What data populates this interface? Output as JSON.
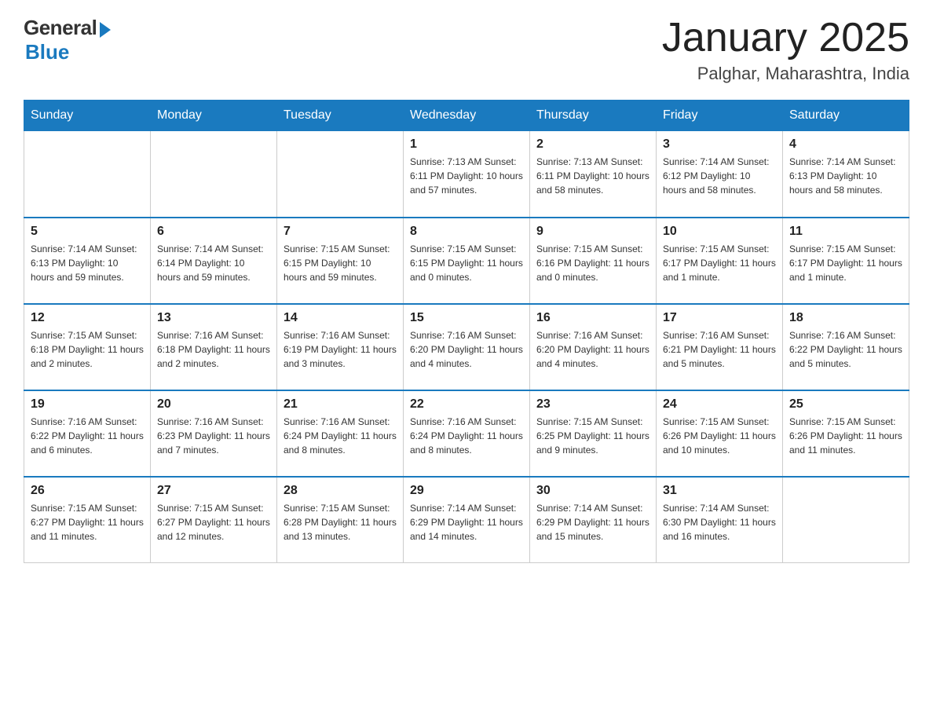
{
  "logo": {
    "general": "General",
    "blue": "Blue"
  },
  "title": "January 2025",
  "location": "Palghar, Maharashtra, India",
  "weekdays": [
    "Sunday",
    "Monday",
    "Tuesday",
    "Wednesday",
    "Thursday",
    "Friday",
    "Saturday"
  ],
  "weeks": [
    [
      {
        "day": "",
        "info": ""
      },
      {
        "day": "",
        "info": ""
      },
      {
        "day": "",
        "info": ""
      },
      {
        "day": "1",
        "info": "Sunrise: 7:13 AM\nSunset: 6:11 PM\nDaylight: 10 hours\nand 57 minutes."
      },
      {
        "day": "2",
        "info": "Sunrise: 7:13 AM\nSunset: 6:11 PM\nDaylight: 10 hours\nand 58 minutes."
      },
      {
        "day": "3",
        "info": "Sunrise: 7:14 AM\nSunset: 6:12 PM\nDaylight: 10 hours\nand 58 minutes."
      },
      {
        "day": "4",
        "info": "Sunrise: 7:14 AM\nSunset: 6:13 PM\nDaylight: 10 hours\nand 58 minutes."
      }
    ],
    [
      {
        "day": "5",
        "info": "Sunrise: 7:14 AM\nSunset: 6:13 PM\nDaylight: 10 hours\nand 59 minutes."
      },
      {
        "day": "6",
        "info": "Sunrise: 7:14 AM\nSunset: 6:14 PM\nDaylight: 10 hours\nand 59 minutes."
      },
      {
        "day": "7",
        "info": "Sunrise: 7:15 AM\nSunset: 6:15 PM\nDaylight: 10 hours\nand 59 minutes."
      },
      {
        "day": "8",
        "info": "Sunrise: 7:15 AM\nSunset: 6:15 PM\nDaylight: 11 hours\nand 0 minutes."
      },
      {
        "day": "9",
        "info": "Sunrise: 7:15 AM\nSunset: 6:16 PM\nDaylight: 11 hours\nand 0 minutes."
      },
      {
        "day": "10",
        "info": "Sunrise: 7:15 AM\nSunset: 6:17 PM\nDaylight: 11 hours\nand 1 minute."
      },
      {
        "day": "11",
        "info": "Sunrise: 7:15 AM\nSunset: 6:17 PM\nDaylight: 11 hours\nand 1 minute."
      }
    ],
    [
      {
        "day": "12",
        "info": "Sunrise: 7:15 AM\nSunset: 6:18 PM\nDaylight: 11 hours\nand 2 minutes."
      },
      {
        "day": "13",
        "info": "Sunrise: 7:16 AM\nSunset: 6:18 PM\nDaylight: 11 hours\nand 2 minutes."
      },
      {
        "day": "14",
        "info": "Sunrise: 7:16 AM\nSunset: 6:19 PM\nDaylight: 11 hours\nand 3 minutes."
      },
      {
        "day": "15",
        "info": "Sunrise: 7:16 AM\nSunset: 6:20 PM\nDaylight: 11 hours\nand 4 minutes."
      },
      {
        "day": "16",
        "info": "Sunrise: 7:16 AM\nSunset: 6:20 PM\nDaylight: 11 hours\nand 4 minutes."
      },
      {
        "day": "17",
        "info": "Sunrise: 7:16 AM\nSunset: 6:21 PM\nDaylight: 11 hours\nand 5 minutes."
      },
      {
        "day": "18",
        "info": "Sunrise: 7:16 AM\nSunset: 6:22 PM\nDaylight: 11 hours\nand 5 minutes."
      }
    ],
    [
      {
        "day": "19",
        "info": "Sunrise: 7:16 AM\nSunset: 6:22 PM\nDaylight: 11 hours\nand 6 minutes."
      },
      {
        "day": "20",
        "info": "Sunrise: 7:16 AM\nSunset: 6:23 PM\nDaylight: 11 hours\nand 7 minutes."
      },
      {
        "day": "21",
        "info": "Sunrise: 7:16 AM\nSunset: 6:24 PM\nDaylight: 11 hours\nand 8 minutes."
      },
      {
        "day": "22",
        "info": "Sunrise: 7:16 AM\nSunset: 6:24 PM\nDaylight: 11 hours\nand 8 minutes."
      },
      {
        "day": "23",
        "info": "Sunrise: 7:15 AM\nSunset: 6:25 PM\nDaylight: 11 hours\nand 9 minutes."
      },
      {
        "day": "24",
        "info": "Sunrise: 7:15 AM\nSunset: 6:26 PM\nDaylight: 11 hours\nand 10 minutes."
      },
      {
        "day": "25",
        "info": "Sunrise: 7:15 AM\nSunset: 6:26 PM\nDaylight: 11 hours\nand 11 minutes."
      }
    ],
    [
      {
        "day": "26",
        "info": "Sunrise: 7:15 AM\nSunset: 6:27 PM\nDaylight: 11 hours\nand 11 minutes."
      },
      {
        "day": "27",
        "info": "Sunrise: 7:15 AM\nSunset: 6:27 PM\nDaylight: 11 hours\nand 12 minutes."
      },
      {
        "day": "28",
        "info": "Sunrise: 7:15 AM\nSunset: 6:28 PM\nDaylight: 11 hours\nand 13 minutes."
      },
      {
        "day": "29",
        "info": "Sunrise: 7:14 AM\nSunset: 6:29 PM\nDaylight: 11 hours\nand 14 minutes."
      },
      {
        "day": "30",
        "info": "Sunrise: 7:14 AM\nSunset: 6:29 PM\nDaylight: 11 hours\nand 15 minutes."
      },
      {
        "day": "31",
        "info": "Sunrise: 7:14 AM\nSunset: 6:30 PM\nDaylight: 11 hours\nand 16 minutes."
      },
      {
        "day": "",
        "info": ""
      }
    ]
  ]
}
